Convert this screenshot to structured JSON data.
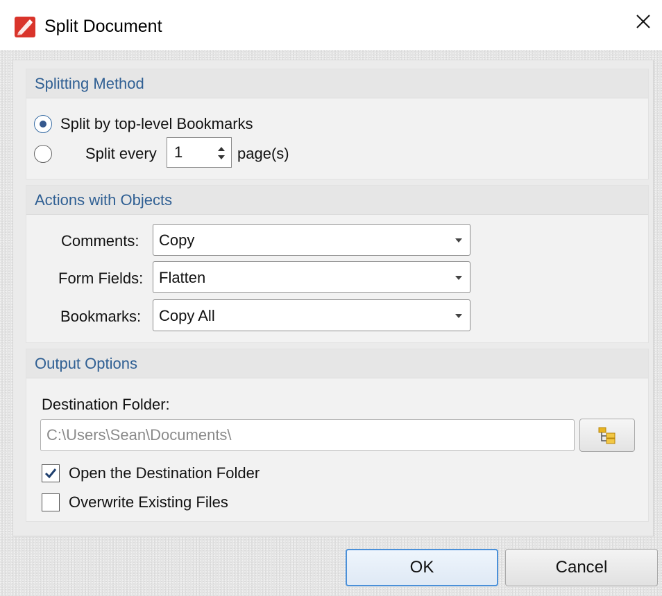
{
  "window": {
    "title": "Split Document"
  },
  "splitting_method": {
    "header": "Splitting Method",
    "option_bookmarks": "Split by top-level Bookmarks",
    "option_every": "Split every",
    "every_value": "1",
    "pages_label": "page(s)",
    "selected": "bookmarks"
  },
  "actions": {
    "header": "Actions with Objects",
    "comments_label": "Comments:",
    "comments_value": "Copy",
    "form_fields_label": "Form Fields:",
    "form_fields_value": "Flatten",
    "bookmarks_label": "Bookmarks:",
    "bookmarks_value": "Copy All"
  },
  "output": {
    "header": "Output Options",
    "destination_label": "Destination Folder:",
    "destination_value": "C:\\Users\\Sean\\Documents\\",
    "open_folder_label": "Open the Destination Folder",
    "open_folder_checked": true,
    "overwrite_label": "Overwrite Existing Files",
    "overwrite_checked": false
  },
  "buttons": {
    "ok_label": "OK",
    "cancel_label": "Cancel"
  },
  "icons": {
    "app": "pdf-app-icon",
    "close": "close-icon",
    "browse": "folder-tree-icon",
    "spin": "spin-arrows-icon",
    "dropdown": "dropdown-arrow-icon",
    "check": "checkmark-icon"
  },
  "colors": {
    "header_text": "#2f5f93",
    "accent": "#4a90d9",
    "app_icon": "#d9342b"
  }
}
